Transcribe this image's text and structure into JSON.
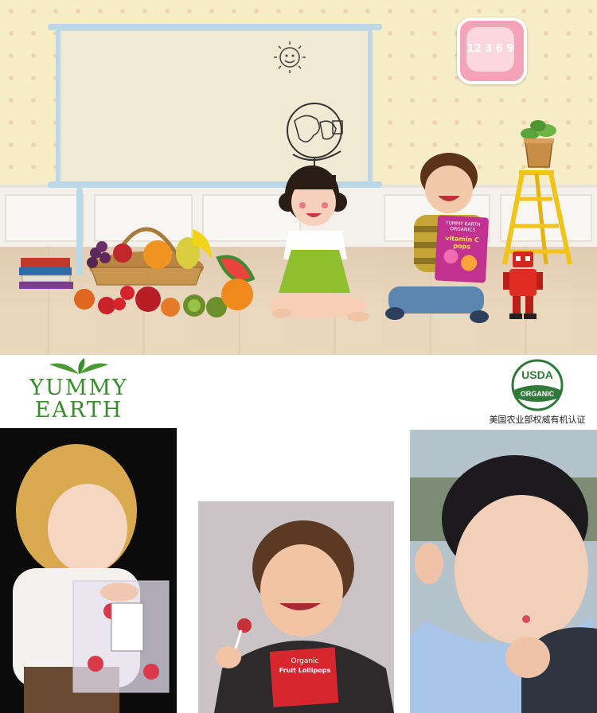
{
  "hero": {
    "clock_numbers": "12 3 6 9",
    "product_bag_text": "vitamin C pops",
    "product_bag_brand": "YUMMY EARTH ORGANICS"
  },
  "brand": {
    "logo_line1": "YUMMY",
    "logo_line2": "EARTH",
    "usda_top": "USDA",
    "usda_bottom": "ORGANIC",
    "usda_caption": "美国农业部权威有机认证"
  },
  "photos": {
    "photo2_bag_line1": "Organic",
    "photo2_bag_line2": "Fruit Lollipops"
  },
  "colors": {
    "brand_green": "#3a8a2e",
    "wall": "#f7edc6",
    "clock_pink": "#f4a3b9",
    "ladder_yellow": "#f2c418",
    "bag_magenta": "#c2318f"
  }
}
